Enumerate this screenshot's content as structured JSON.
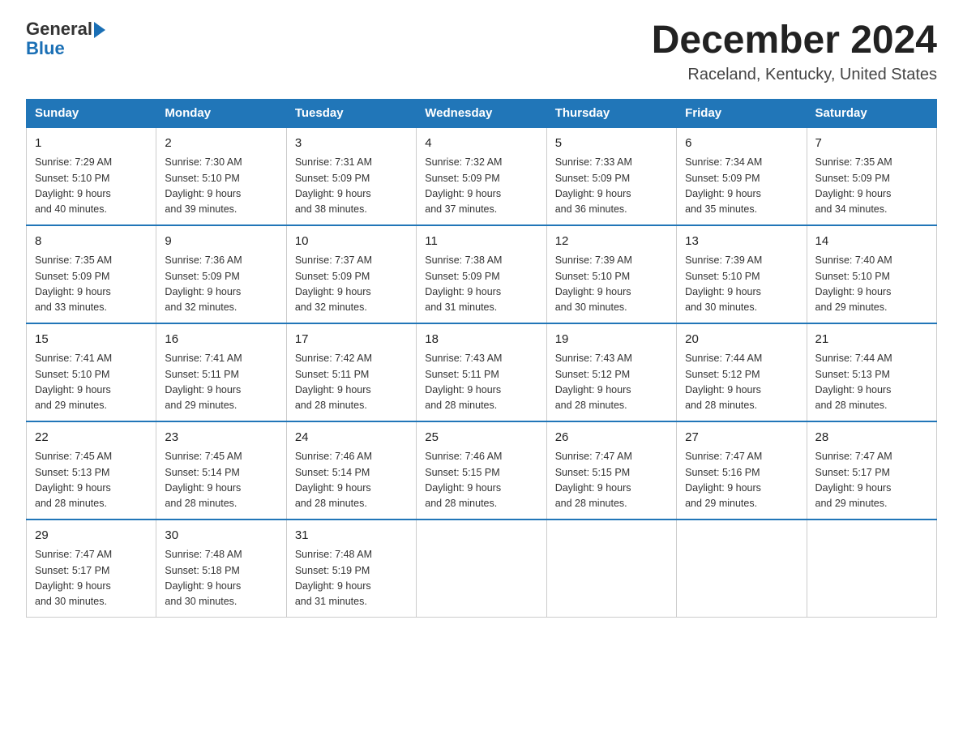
{
  "header": {
    "logo_general": "General",
    "logo_blue": "Blue",
    "title": "December 2024",
    "subtitle": "Raceland, Kentucky, United States"
  },
  "days_of_week": [
    "Sunday",
    "Monday",
    "Tuesday",
    "Wednesday",
    "Thursday",
    "Friday",
    "Saturday"
  ],
  "weeks": [
    [
      {
        "day": "1",
        "sunrise": "7:29 AM",
        "sunset": "5:10 PM",
        "daylight": "9 hours and 40 minutes."
      },
      {
        "day": "2",
        "sunrise": "7:30 AM",
        "sunset": "5:10 PM",
        "daylight": "9 hours and 39 minutes."
      },
      {
        "day": "3",
        "sunrise": "7:31 AM",
        "sunset": "5:09 PM",
        "daylight": "9 hours and 38 minutes."
      },
      {
        "day": "4",
        "sunrise": "7:32 AM",
        "sunset": "5:09 PM",
        "daylight": "9 hours and 37 minutes."
      },
      {
        "day": "5",
        "sunrise": "7:33 AM",
        "sunset": "5:09 PM",
        "daylight": "9 hours and 36 minutes."
      },
      {
        "day": "6",
        "sunrise": "7:34 AM",
        "sunset": "5:09 PM",
        "daylight": "9 hours and 35 minutes."
      },
      {
        "day": "7",
        "sunrise": "7:35 AM",
        "sunset": "5:09 PM",
        "daylight": "9 hours and 34 minutes."
      }
    ],
    [
      {
        "day": "8",
        "sunrise": "7:35 AM",
        "sunset": "5:09 PM",
        "daylight": "9 hours and 33 minutes."
      },
      {
        "day": "9",
        "sunrise": "7:36 AM",
        "sunset": "5:09 PM",
        "daylight": "9 hours and 32 minutes."
      },
      {
        "day": "10",
        "sunrise": "7:37 AM",
        "sunset": "5:09 PM",
        "daylight": "9 hours and 32 minutes."
      },
      {
        "day": "11",
        "sunrise": "7:38 AM",
        "sunset": "5:09 PM",
        "daylight": "9 hours and 31 minutes."
      },
      {
        "day": "12",
        "sunrise": "7:39 AM",
        "sunset": "5:10 PM",
        "daylight": "9 hours and 30 minutes."
      },
      {
        "day": "13",
        "sunrise": "7:39 AM",
        "sunset": "5:10 PM",
        "daylight": "9 hours and 30 minutes."
      },
      {
        "day": "14",
        "sunrise": "7:40 AM",
        "sunset": "5:10 PM",
        "daylight": "9 hours and 29 minutes."
      }
    ],
    [
      {
        "day": "15",
        "sunrise": "7:41 AM",
        "sunset": "5:10 PM",
        "daylight": "9 hours and 29 minutes."
      },
      {
        "day": "16",
        "sunrise": "7:41 AM",
        "sunset": "5:11 PM",
        "daylight": "9 hours and 29 minutes."
      },
      {
        "day": "17",
        "sunrise": "7:42 AM",
        "sunset": "5:11 PM",
        "daylight": "9 hours and 28 minutes."
      },
      {
        "day": "18",
        "sunrise": "7:43 AM",
        "sunset": "5:11 PM",
        "daylight": "9 hours and 28 minutes."
      },
      {
        "day": "19",
        "sunrise": "7:43 AM",
        "sunset": "5:12 PM",
        "daylight": "9 hours and 28 minutes."
      },
      {
        "day": "20",
        "sunrise": "7:44 AM",
        "sunset": "5:12 PM",
        "daylight": "9 hours and 28 minutes."
      },
      {
        "day": "21",
        "sunrise": "7:44 AM",
        "sunset": "5:13 PM",
        "daylight": "9 hours and 28 minutes."
      }
    ],
    [
      {
        "day": "22",
        "sunrise": "7:45 AM",
        "sunset": "5:13 PM",
        "daylight": "9 hours and 28 minutes."
      },
      {
        "day": "23",
        "sunrise": "7:45 AM",
        "sunset": "5:14 PM",
        "daylight": "9 hours and 28 minutes."
      },
      {
        "day": "24",
        "sunrise": "7:46 AM",
        "sunset": "5:14 PM",
        "daylight": "9 hours and 28 minutes."
      },
      {
        "day": "25",
        "sunrise": "7:46 AM",
        "sunset": "5:15 PM",
        "daylight": "9 hours and 28 minutes."
      },
      {
        "day": "26",
        "sunrise": "7:47 AM",
        "sunset": "5:15 PM",
        "daylight": "9 hours and 28 minutes."
      },
      {
        "day": "27",
        "sunrise": "7:47 AM",
        "sunset": "5:16 PM",
        "daylight": "9 hours and 29 minutes."
      },
      {
        "day": "28",
        "sunrise": "7:47 AM",
        "sunset": "5:17 PM",
        "daylight": "9 hours and 29 minutes."
      }
    ],
    [
      {
        "day": "29",
        "sunrise": "7:47 AM",
        "sunset": "5:17 PM",
        "daylight": "9 hours and 30 minutes."
      },
      {
        "day": "30",
        "sunrise": "7:48 AM",
        "sunset": "5:18 PM",
        "daylight": "9 hours and 30 minutes."
      },
      {
        "day": "31",
        "sunrise": "7:48 AM",
        "sunset": "5:19 PM",
        "daylight": "9 hours and 31 minutes."
      },
      null,
      null,
      null,
      null
    ]
  ],
  "labels": {
    "sunrise": "Sunrise:",
    "sunset": "Sunset:",
    "daylight": "Daylight:"
  }
}
